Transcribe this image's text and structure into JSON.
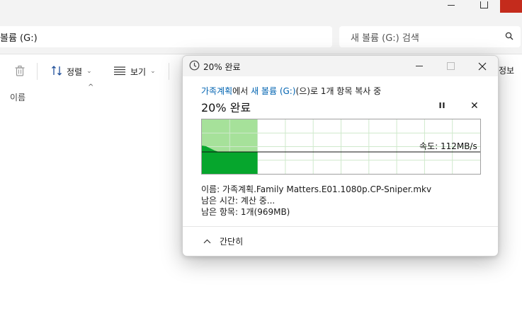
{
  "explorer": {
    "title_path": "볼륨 (G:)",
    "search_placeholder": "새 볼륨 (G:) 검색",
    "toolbar": {
      "sort_label": "정렬",
      "view_label": "보기",
      "details_label": "정보"
    },
    "column_header_name": "이름"
  },
  "dialog": {
    "title": "20% 완료",
    "copy_source": "가족계획",
    "copy_mid": "에서 ",
    "copy_dest": "새 볼륨 (G:)",
    "copy_tail": "(으)로 1개 항목 복사 중",
    "percent_heading": "20% 완료",
    "progress_fraction": 0.2,
    "speed_label": "속도: 112MB/s",
    "details": {
      "name_line": "이름: 가족계획.Family Matters.E01.1080p.CP-Sniper.mkv",
      "time_line": "남은 시간: 계산 중...",
      "items_line": "남은 항목: 1개(969MB)"
    },
    "collapse_label": "간단히"
  },
  "colors": {
    "progress_light": "#a6e19a",
    "progress_dark": "#06a62d",
    "link": "#0063b1",
    "close_red": "#c42b1c"
  },
  "icons": [
    "trash-icon",
    "sort-icon",
    "view-icon",
    "search-icon",
    "clock-icon",
    "pause-icon",
    "cancel-icon",
    "chevron-up-icon"
  ]
}
